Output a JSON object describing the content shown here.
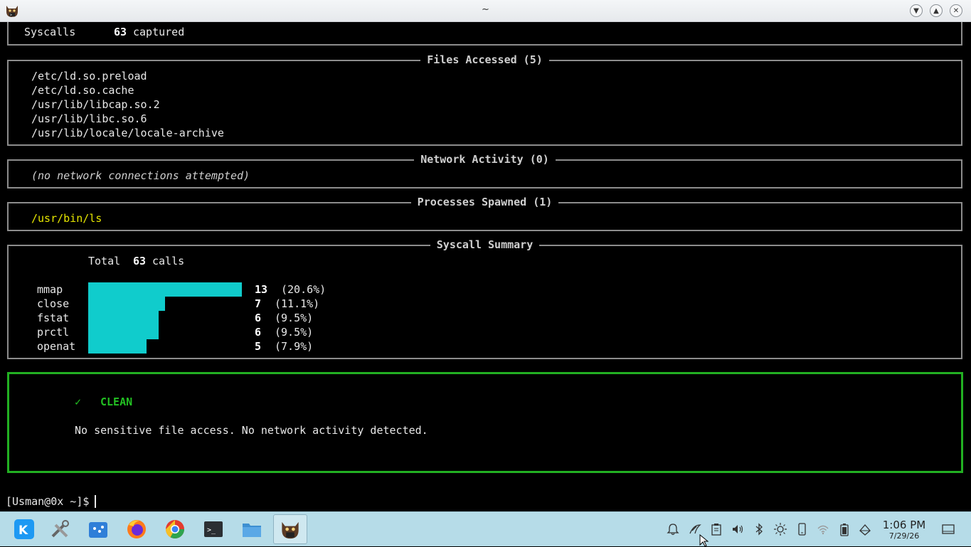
{
  "window": {
    "title": "~"
  },
  "terminal": {
    "syscalls_row": {
      "label": "Syscalls",
      "count": "63",
      "suffix": "captured"
    },
    "files": {
      "title": "Files Accessed (5)",
      "items": [
        "/etc/ld.so.preload",
        "/etc/ld.so.cache",
        "/usr/lib/libcap.so.2",
        "/usr/lib/libc.so.6",
        "/usr/lib/locale/locale-archive"
      ]
    },
    "network": {
      "title": "Network Activity (0)",
      "message": "(no network connections attempted)"
    },
    "processes": {
      "title": "Processes Spawned (1)",
      "items": [
        "/usr/bin/ls"
      ]
    },
    "summary": {
      "title": "Syscall Summary",
      "total_label": "Total",
      "total_value": "63",
      "total_suffix": "calls",
      "rows": [
        {
          "name": "mmap",
          "count": "13",
          "pct": "(20.6%)",
          "fraction": 1.0
        },
        {
          "name": "close",
          "count": "7",
          "pct": "(11.1%)",
          "fraction": 0.5
        },
        {
          "name": "fstat",
          "count": "6",
          "pct": "(9.5%)",
          "fraction": 0.46
        },
        {
          "name": "prctl",
          "count": "6",
          "pct": "(9.5%)",
          "fraction": 0.46
        },
        {
          "name": "openat",
          "count": "5",
          "pct": "(7.9%)",
          "fraction": 0.38
        }
      ]
    },
    "verdict": {
      "icon": "✓",
      "status": "CLEAN",
      "message": "No sensitive file access. No network activity detected."
    },
    "prompt": "[Usman@0x ~]$"
  },
  "taskbar": {
    "apps": [
      "application-launcher",
      "system-settings",
      "discover",
      "firefox",
      "chrome",
      "konsole",
      "dolphin",
      "terminal-app"
    ],
    "clock": {
      "time": "1:06 PM",
      "date": "7/29/26"
    }
  },
  "colors": {
    "bar": "#10cccc",
    "clean": "#22b022",
    "path_highlight": "#e6e600"
  }
}
